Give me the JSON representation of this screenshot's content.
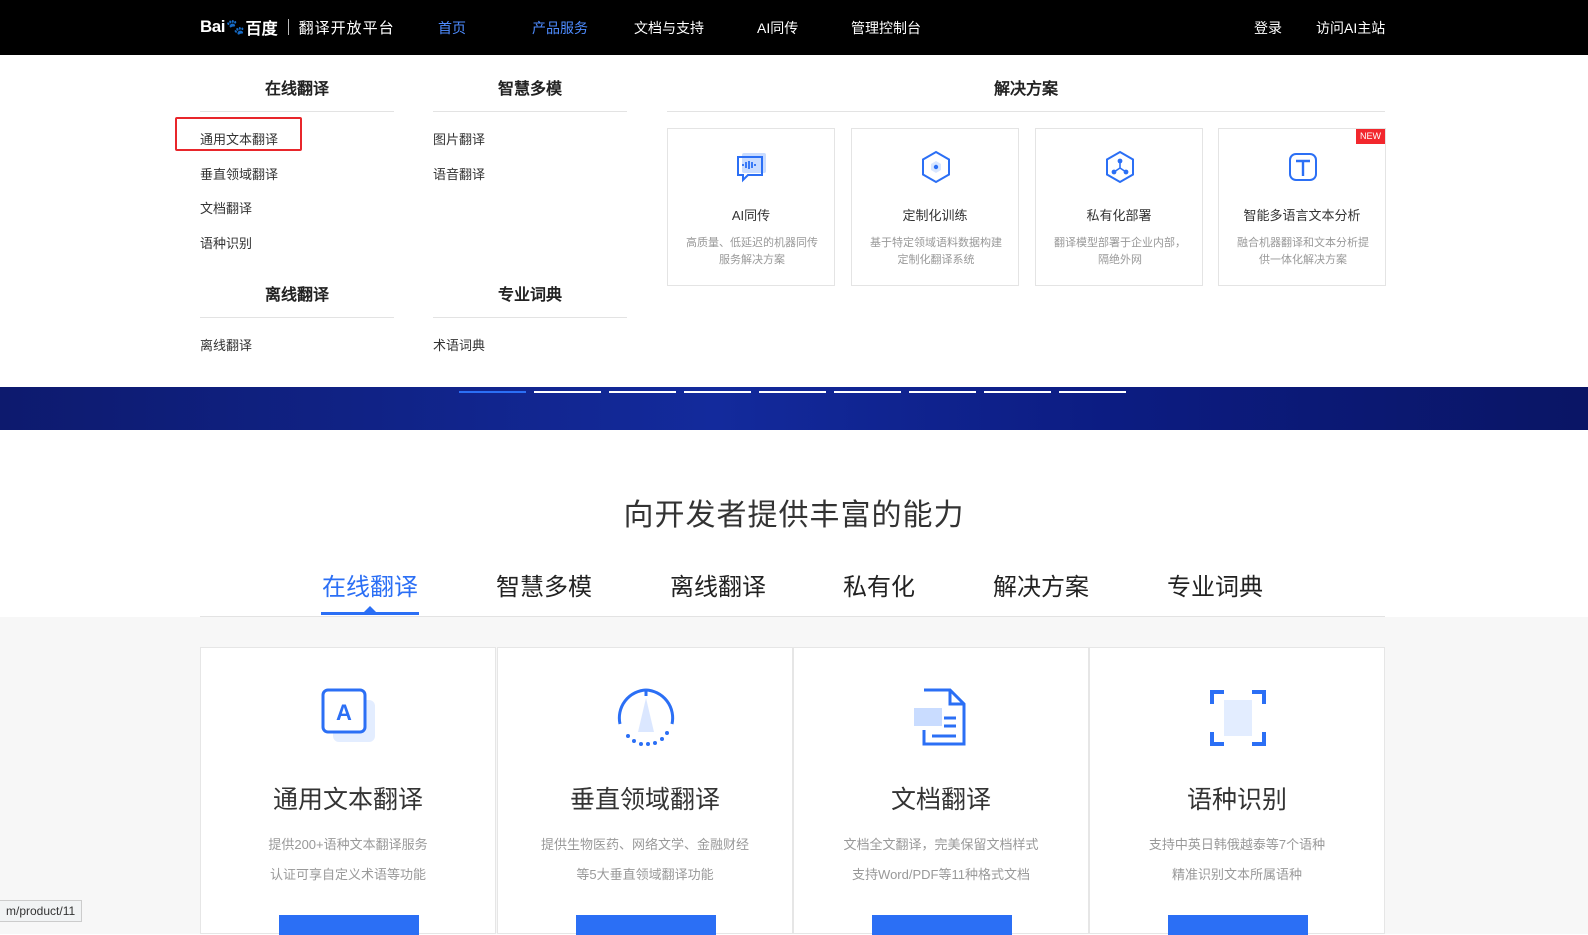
{
  "brand": {
    "bai": "Bai",
    "du": "百度",
    "title": "翻译开放平台"
  },
  "nav": {
    "items": [
      "首页",
      "产品服务",
      "文档与支持",
      "AI同传",
      "管理控制台"
    ],
    "login": "登录",
    "visit": "访问AI主站"
  },
  "menu": {
    "online": {
      "title": "在线翻译",
      "links": [
        "通用文本翻译",
        "垂直领域翻译",
        "文档翻译",
        "语种识别"
      ]
    },
    "multimodal": {
      "title": "智慧多模",
      "links": [
        "图片翻译",
        "语音翻译"
      ]
    },
    "offline": {
      "title": "离线翻译",
      "links": [
        "离线翻译"
      ]
    },
    "dictionary": {
      "title": "专业词典",
      "links": [
        "术语词典"
      ]
    },
    "solutions": {
      "title": "解决方案",
      "cards": [
        {
          "name": "AI同传",
          "desc": "高质量、低延迟的机器同传服务解决方案"
        },
        {
          "name": "定制化训练",
          "desc": "基于特定领域语料数据构建定制化翻译系统"
        },
        {
          "name": "私有化部署",
          "desc": "翻译模型部署于企业内部，隔绝外网"
        },
        {
          "name": "智能多语言文本分析",
          "desc": "融合机器翻译和文本分析提供一体化解决方案",
          "badge": "NEW"
        }
      ]
    }
  },
  "section": {
    "title": "向开发者提供丰富的能力",
    "tabs": [
      "在线翻译",
      "智慧多模",
      "离线翻译",
      "私有化",
      "解决方案",
      "专业词典"
    ],
    "products": [
      {
        "name": "通用文本翻译",
        "desc1": "提供200+语种文本翻译服务",
        "desc2": "认证可享自定义术语等功能"
      },
      {
        "name": "垂直领域翻译",
        "desc1": "提供生物医药、网络文学、金融财经",
        "desc2": "等5大垂直领域翻译功能"
      },
      {
        "name": "文档翻译",
        "desc1": "文档全文翻译，完美保留文档样式",
        "desc2": "支持Word/PDF等11种格式文档"
      },
      {
        "name": "语种识别",
        "desc1": "支持中英日韩俄越泰等7个语种",
        "desc2": "精准识别文本所属语种"
      }
    ]
  },
  "status_url": "m/product/11",
  "colors": {
    "accent": "#2b6ff5",
    "highlight": "#e8262b",
    "nav_bg": "#000000",
    "hero": "#132a9c"
  }
}
